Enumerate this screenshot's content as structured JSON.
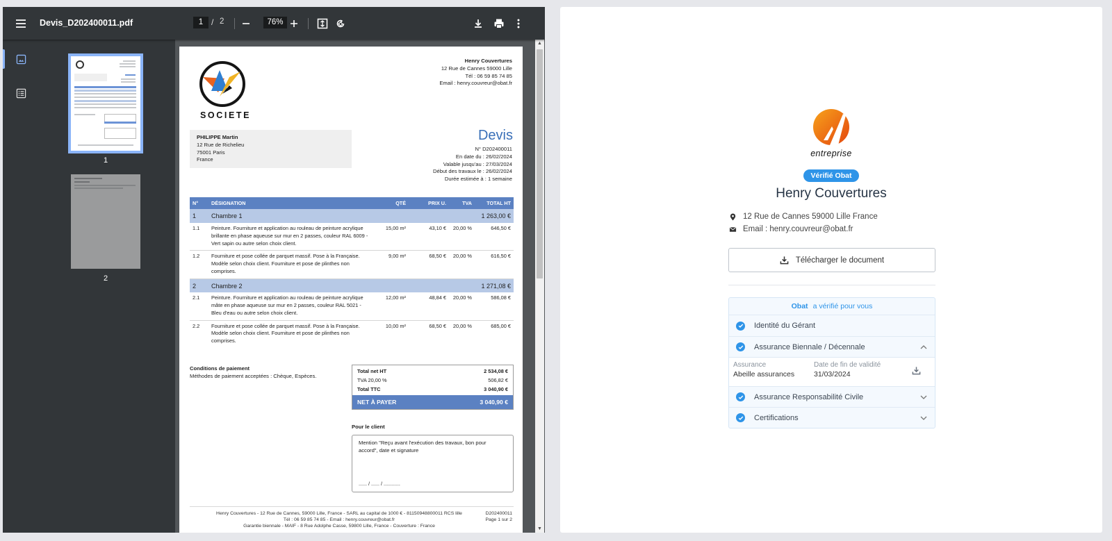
{
  "viewer": {
    "file_name": "Devis_D202400011.pdf",
    "current_page": "1",
    "page_separator": "/",
    "total_pages": "2",
    "zoom": "76%",
    "thumbnails": [
      {
        "label": "1"
      },
      {
        "label": "2"
      }
    ]
  },
  "pdf": {
    "logo_text": "SOCIETE",
    "company": {
      "name": "Henry Couvertures",
      "address": "12 Rue de Cannes 59000 Lille",
      "phone": "Tél : 06 59 85 74 85",
      "email": "Email : henry.couvreur@obat.fr"
    },
    "client": {
      "name": "PHILIPPE Martin",
      "street": "12 Rue de Richelieu",
      "city": "75001 Paris",
      "country": "France"
    },
    "doc_title": "Devis",
    "meta": {
      "number": "N° D202400011",
      "date": "En date du : 26/02/2024",
      "valid_until": "Valable jusqu'au : 27/03/2024",
      "start": "Début des travaux le : 26/02/2024",
      "duration": "Durée estimée à : 1 semaine"
    },
    "table_headers": {
      "num": "N°",
      "designation": "DÉSIGNATION",
      "qty": "QTÉ",
      "unit_price": "PRIX U.",
      "vat": "TVA",
      "total": "TOTAL HT"
    },
    "sections": [
      {
        "num": "1",
        "title": "Chambre 1",
        "total": "1 263,00 €",
        "items": [
          {
            "num": "1.1",
            "desc": "Peinture. Fourniture et application au rouleau de peinture acrylique brillante en phase aqueuse sur mur en 2 passes, couleur RAL 6009 - Vert sapin ou autre selon choix client.",
            "qty": "15,00 m²",
            "price": "43,10 €",
            "vat": "20,00 %",
            "total": "646,50 €"
          },
          {
            "num": "1.2",
            "desc": "Fourniture et pose collée de parquet massif. Pose à la Française. Modèle selon choix client. Fourniture et pose de plinthes non comprises.",
            "qty": "9,00 m²",
            "price": "68,50 €",
            "vat": "20,00 %",
            "total": "616,50 €"
          }
        ]
      },
      {
        "num": "2",
        "title": "Chambre 2",
        "total": "1 271,08 €",
        "items": [
          {
            "num": "2.1",
            "desc": "Peinture. Fourniture et application au rouleau de peinture acrylique mâte en phase aqueuse sur mur en 2 passes, couleur RAL 5021 - Bleu d'eau ou autre selon choix client.",
            "qty": "12,00 m²",
            "price": "48,84 €",
            "vat": "20,00 %",
            "total": "586,08 €"
          },
          {
            "num": "2.2",
            "desc": "Fourniture et pose collée de parquet massif. Pose à la Française. Modèle selon choix client. Fourniture et pose de plinthes non comprises.",
            "qty": "10,00 m²",
            "price": "68,50 €",
            "vat": "20,00 %",
            "total": "685,00 €"
          }
        ]
      }
    ],
    "conditions": {
      "title": "Conditions de paiement",
      "text": "Méthodes de paiement acceptées : Chèque, Espèces."
    },
    "totals": {
      "net_ht_label": "Total net HT",
      "net_ht": "2 534,08 €",
      "vat_label": "TVA 20,00 %",
      "vat": "506,82 €",
      "ttc_label": "Total TTC",
      "ttc": "3 040,90 €",
      "to_pay_label": "NET À PAYER",
      "to_pay": "3 040,90 €"
    },
    "signature": {
      "title": "Pour le client",
      "mention": "Mention \"Reçu avant l'exécution des travaux, bon pour accord\", date et signature",
      "dots": "...... / ...... / ............"
    },
    "footer": {
      "line1": "Henry Couvertures - 12 Rue de Cannes, 59000 Lille, France - SARL au capital de 1000 € - 81150948800011 RCS lille",
      "line2": "Tél : 06 59 85 74 85 - Email : henry.couvreur@obat.fr",
      "line3": "Garantie biennale - MAIF - 8 Rue Adolphe Casse, 59800 Lille, France - Couverture : France",
      "ref": "D202400011",
      "page": "Page 1 sur 2"
    }
  },
  "side": {
    "logo_text": "entreprise",
    "badge": "Vérifié  Obat",
    "company_name": "Henry Couvertures",
    "address": "12 Rue de Cannes 59000 Lille France",
    "email": "Email : henry.couvreur@obat.fr",
    "download_label": "Télécharger le document",
    "verif_brand": "Obat",
    "verif_title": "a vérifié pour vous",
    "checks": {
      "identity": "Identité du Gérant",
      "biennale": "Assurance Biennale / Décennale",
      "rc": "Assurance Responsabilité Civile",
      "certifications": "Certifications"
    },
    "assurance": {
      "label": "Assurance",
      "value": "Abeille assurances",
      "end_label": "Date de fin de validité",
      "end_value": "31/03/2024"
    },
    "colors": {
      "accent": "#2e94e8",
      "viewer_bg": "#323639",
      "table_header": "#5b81c2"
    }
  }
}
